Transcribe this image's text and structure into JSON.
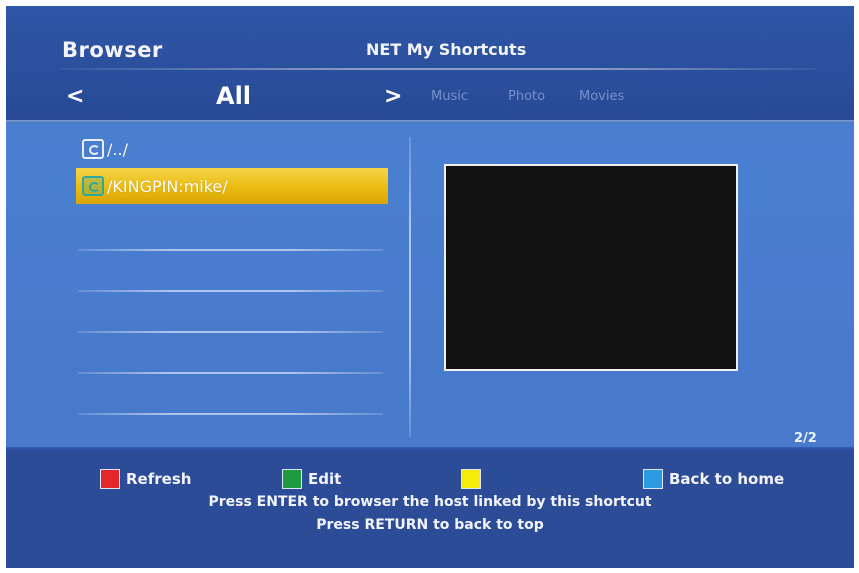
{
  "header": {
    "app_title": "Browser",
    "section_title": "NET My Shortcuts",
    "nav_left": "<",
    "nav_right": ">",
    "current_filter": "All",
    "filter_tabs": [
      "Music",
      "Photo",
      "Movies"
    ]
  },
  "file_list": {
    "items": [
      {
        "label": "/../",
        "icon": "folder-link-icon",
        "selected": false
      },
      {
        "label": "/KINGPIN:mike/",
        "icon": "folder-link-icon",
        "selected": true
      }
    ],
    "selection_color": "#e9bb10"
  },
  "preview": {
    "background": "#111111"
  },
  "page_indicator": "2/2",
  "footer": {
    "keys": [
      {
        "color": "#e3262a",
        "label": "Refresh"
      },
      {
        "color": "#1f9a3e",
        "label": "Edit"
      },
      {
        "color": "#f4ea0c",
        "label": ""
      },
      {
        "color": "#2a9be0",
        "label": "Back to home"
      }
    ],
    "hint_enter": "Press ENTER to browser the host linked by this shortcut",
    "hint_return": "Press RETURN to back to top"
  }
}
